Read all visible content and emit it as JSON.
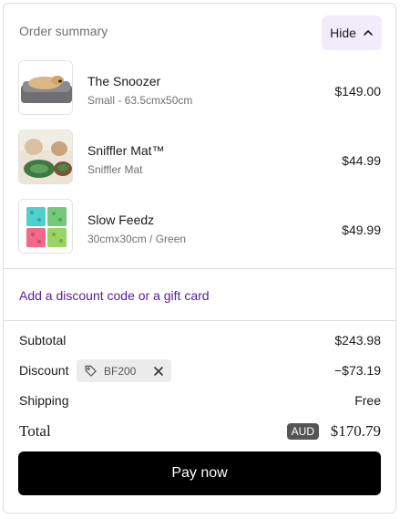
{
  "summary": {
    "title": "Order summary",
    "toggle_label": "Hide",
    "toggle_icon": "chevron-up-icon"
  },
  "items": [
    {
      "name": "The Snoozer",
      "variant": "Small - 63.5cmx50cm",
      "price": "$149.00",
      "image": "dog-bed-photo"
    },
    {
      "name": "Sniffler Mat™",
      "variant": "Sniffler Mat",
      "price": "$44.99",
      "image": "snuffle-mat-photo"
    },
    {
      "name": "Slow Feedz",
      "variant": "30cmx30cm / Green",
      "price": "$49.99",
      "image": "slow-feeder-photo"
    }
  ],
  "discount": {
    "link_label": "Add a discount code or a gift card",
    "code": "BF200",
    "code_icon": "tag-icon",
    "remove_icon": "close-icon"
  },
  "totals": {
    "subtotal_label": "Subtotal",
    "subtotal_value": "$243.98",
    "discount_label": "Discount",
    "discount_value": "−$73.19",
    "shipping_label": "Shipping",
    "shipping_value": "Free",
    "total_label": "Total",
    "currency": "AUD",
    "total_value": "$170.79"
  },
  "pay_button": {
    "label": "Pay now"
  },
  "colors": {
    "accent": "#5a1aa0",
    "toggle_bg": "#f1ecfb",
    "pay_button_bg": "#000000"
  }
}
